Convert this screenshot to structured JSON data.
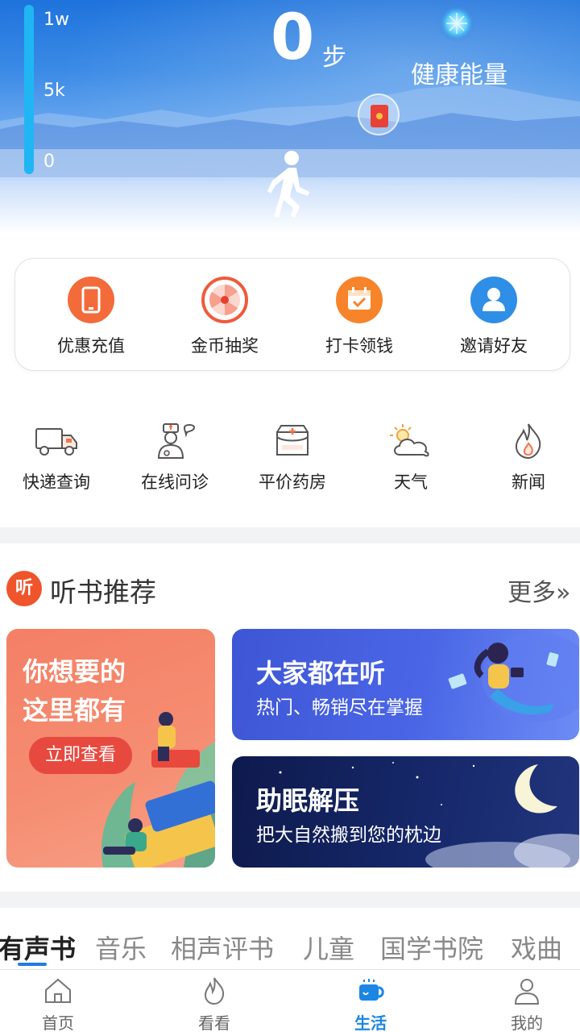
{
  "header": {
    "scale_labels": [
      "1w",
      "5k",
      "0"
    ],
    "steps": "0",
    "steps_unit": "步",
    "energy_label": "健康能量"
  },
  "quick_actions": [
    {
      "label": "优惠充值",
      "icon": "tablet-icon",
      "color": "#f36b3b"
    },
    {
      "label": "金币抽奖",
      "icon": "lottery-wheel-icon",
      "color": "#f05a3b"
    },
    {
      "label": "打卡领钱",
      "icon": "calendar-check-icon",
      "color": "#f7842a"
    },
    {
      "label": "邀请好友",
      "icon": "user-icon",
      "color": "#2f8ee6"
    }
  ],
  "services": [
    {
      "label": "快递查询",
      "icon": "truck-icon"
    },
    {
      "label": "在线问诊",
      "icon": "doctor-icon"
    },
    {
      "label": "平价药房",
      "icon": "medicine-box-icon"
    },
    {
      "label": "天气",
      "icon": "weather-icon"
    },
    {
      "label": "新闻",
      "icon": "flame-icon"
    }
  ],
  "audiobook": {
    "icon_text": "听",
    "title": "听书推荐",
    "more": "更多»",
    "feature_card": {
      "line1": "你想要的",
      "line2": "这里都有",
      "button": "立即查看"
    },
    "popular_card": {
      "title": "大家都在听",
      "subtitle": "热门、畅销尽在掌握"
    },
    "sleep_card": {
      "title": "助眠解压",
      "subtitle": "把大自然搬到您的枕边"
    }
  },
  "categories": [
    "有声书",
    "音乐",
    "相声评书",
    "儿童",
    "国学书院",
    "戏曲"
  ],
  "bottom_nav": [
    {
      "label": "首页",
      "icon": "home-icon"
    },
    {
      "label": "看看",
      "icon": "flame-outline-icon"
    },
    {
      "label": "生活",
      "icon": "coffee-cup-icon",
      "active": true
    },
    {
      "label": "我的",
      "icon": "person-icon"
    }
  ],
  "colors": {
    "accent": "#1b86e4",
    "header_blue": "#1e73dc",
    "progress": "#20b6f4"
  }
}
